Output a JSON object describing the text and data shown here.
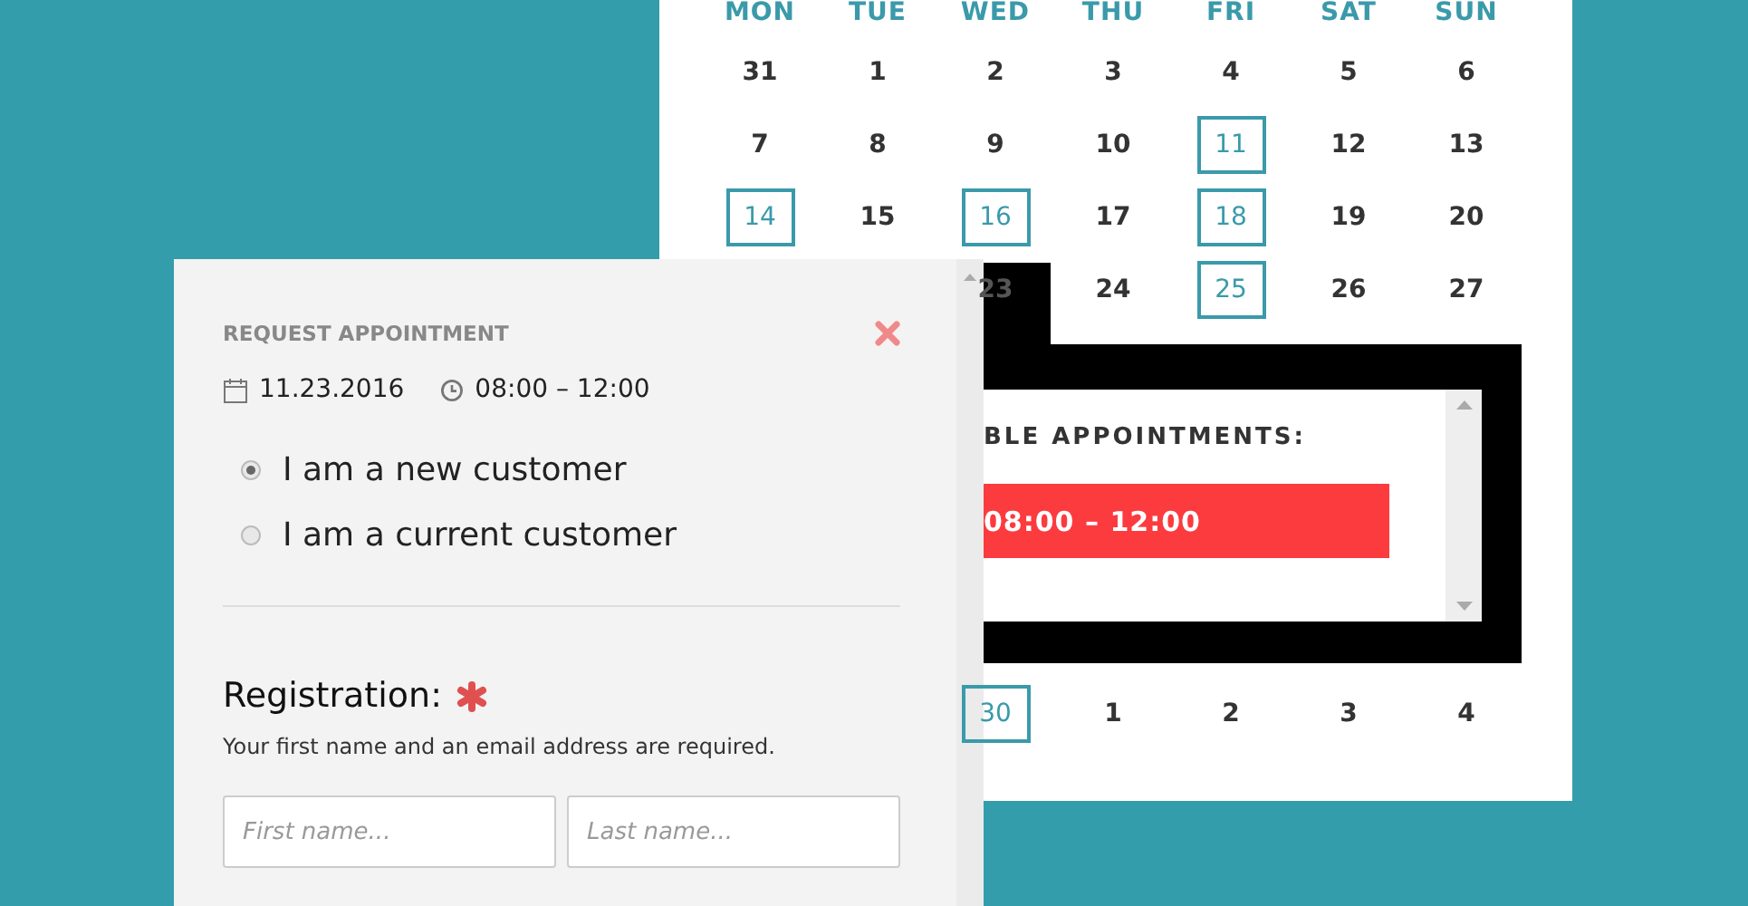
{
  "calendar": {
    "weekdays": [
      "MON",
      "TUE",
      "WED",
      "THU",
      "FRI",
      "SAT",
      "SUN"
    ],
    "weeks": [
      [
        {
          "day": "31",
          "marked": false
        },
        {
          "day": "1",
          "marked": false
        },
        {
          "day": "2",
          "marked": false
        },
        {
          "day": "3",
          "marked": false
        },
        {
          "day": "4",
          "marked": false
        },
        {
          "day": "5",
          "marked": false
        },
        {
          "day": "6",
          "marked": false
        }
      ],
      [
        {
          "day": "7",
          "marked": false
        },
        {
          "day": "8",
          "marked": false
        },
        {
          "day": "9",
          "marked": false
        },
        {
          "day": "10",
          "marked": false
        },
        {
          "day": "11",
          "marked": true
        },
        {
          "day": "12",
          "marked": false
        },
        {
          "day": "13",
          "marked": false
        }
      ],
      [
        {
          "day": "14",
          "marked": true
        },
        {
          "day": "15",
          "marked": false
        },
        {
          "day": "16",
          "marked": true
        },
        {
          "day": "17",
          "marked": false
        },
        {
          "day": "18",
          "marked": true
        },
        {
          "day": "19",
          "marked": false
        },
        {
          "day": "20",
          "marked": false
        }
      ],
      [
        {
          "day": "23",
          "marked": false
        },
        {
          "day": "24",
          "marked": false
        },
        {
          "day": "25",
          "marked": true
        },
        {
          "day": "26",
          "marked": false
        },
        {
          "day": "27",
          "marked": false
        }
      ],
      [
        {
          "day": "30",
          "marked": true
        },
        {
          "day": "1",
          "marked": false
        },
        {
          "day": "2",
          "marked": false
        },
        {
          "day": "3",
          "marked": false
        },
        {
          "day": "4",
          "marked": false
        }
      ]
    ]
  },
  "appointments_popup": {
    "title": "BLE APPOINTMENTS:",
    "slots": [
      "08:00 – 12:00"
    ]
  },
  "request_form": {
    "title": "REQUEST APPOINTMENT",
    "date": "11.23.2016",
    "time": "08:00 – 12:00",
    "customer_options": [
      {
        "label": "I am a new customer",
        "selected": true
      },
      {
        "label": "I am a current customer",
        "selected": false
      }
    ],
    "registration_heading": "Registration:",
    "required_note": "Your first name and an email address are required.",
    "fields": [
      {
        "placeholder": "First name..."
      },
      {
        "placeholder": "Last name..."
      }
    ]
  }
}
